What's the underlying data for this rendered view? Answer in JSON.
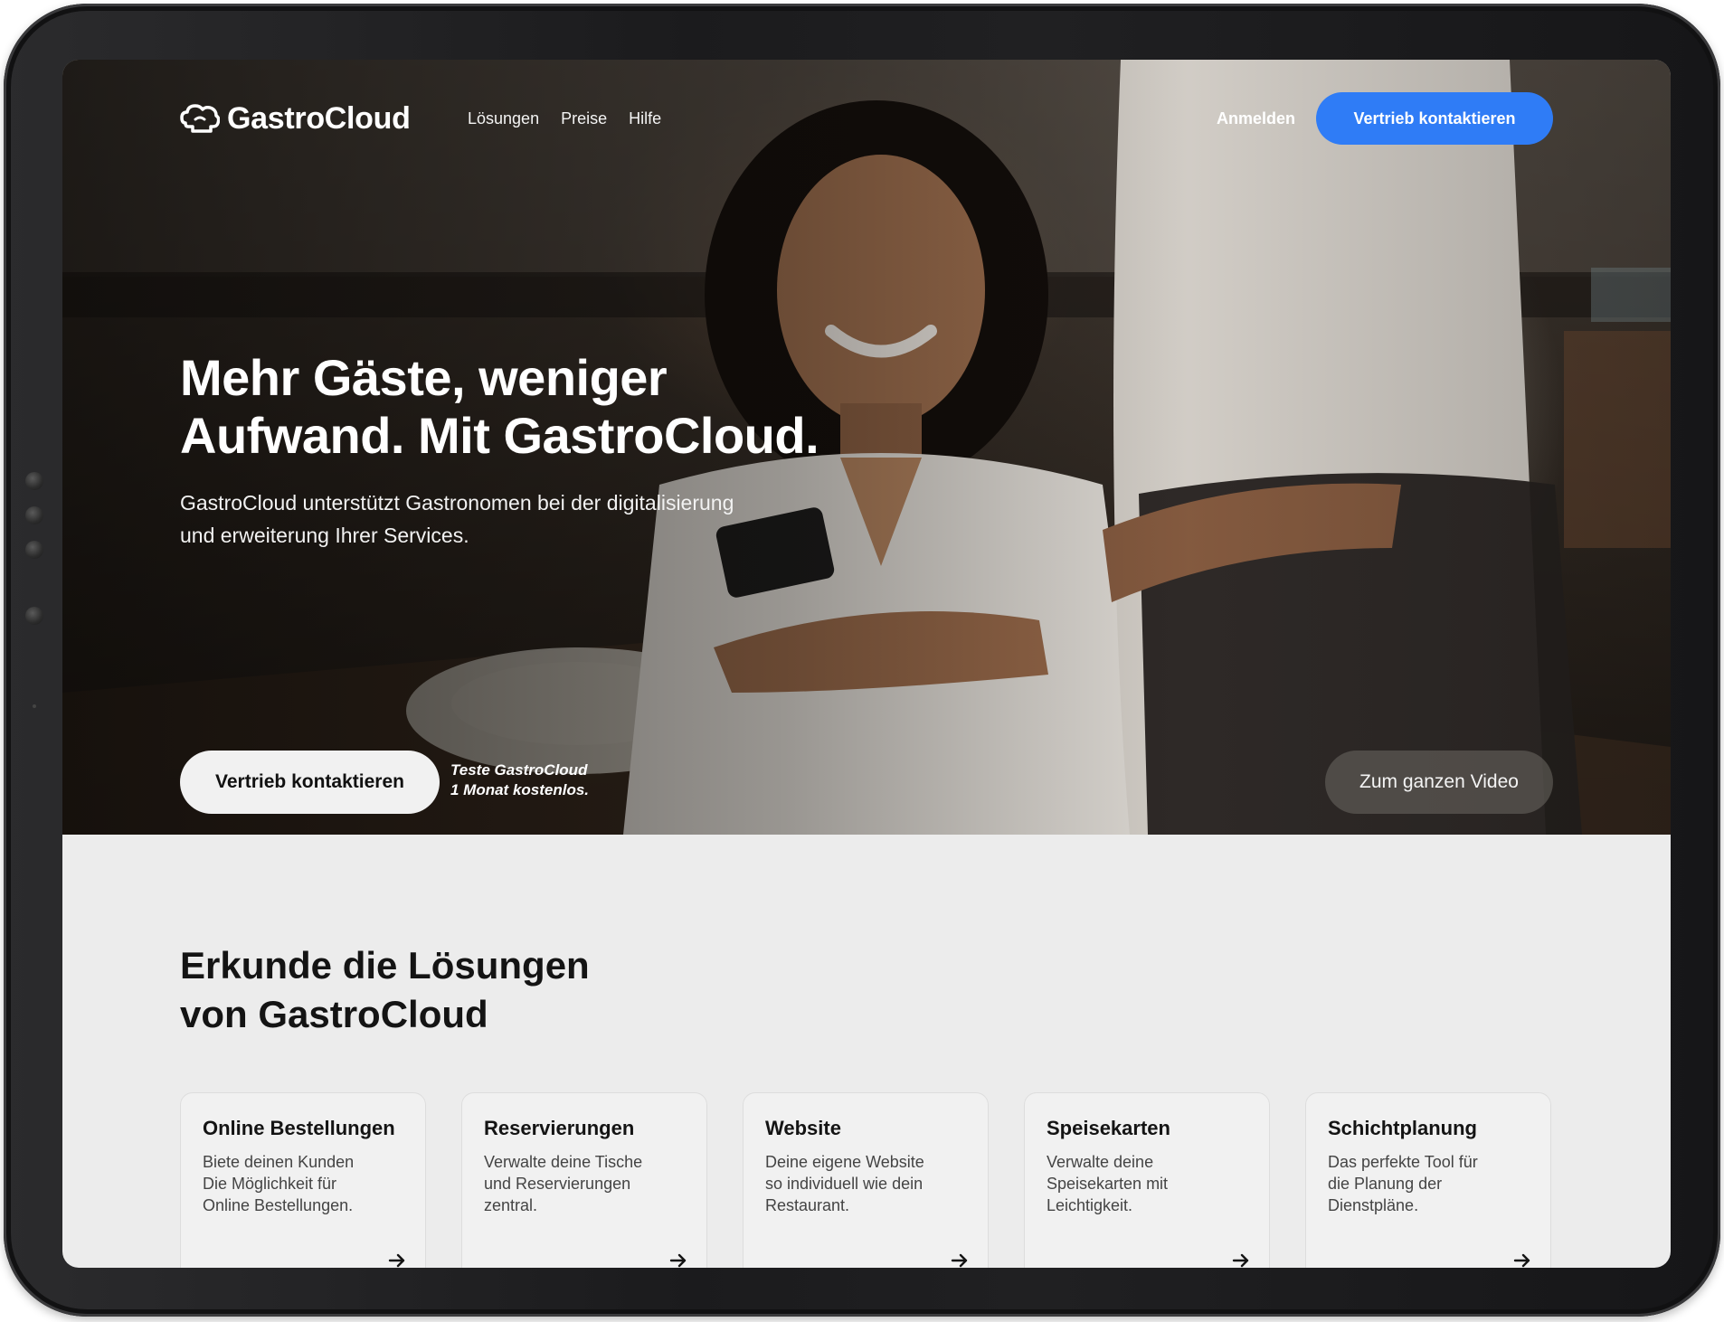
{
  "nav": {
    "logo": "GastroCloud",
    "links": [
      "Lösungen",
      "Preise",
      "Hilfe"
    ],
    "login": "Anmelden",
    "cta": "Vertrieb kontaktieren"
  },
  "hero": {
    "headline_line1": "Mehr Gäste, weniger",
    "headline_line2": "Aufwand. Mit GastroCloud.",
    "subline_line1": "GastroCloud unterstützt Gastronomen bei der digitalisierung",
    "subline_line2": "und erweiterung Ihrer Services.",
    "cta": "Vertrieb kontaktieren",
    "trial_line1": "Teste GastroCloud",
    "trial_line2": "1 Monat kostenlos.",
    "video_button": "Zum ganzen Video"
  },
  "solutions": {
    "title_line1": "Erkunde die Lösungen",
    "title_line2": "von GastroCloud",
    "cards": [
      {
        "title": "Online Bestellungen",
        "text": [
          "Biete deinen Kunden",
          "Die Möglichkeit für",
          "Online Bestellungen."
        ]
      },
      {
        "title": "Reservierungen",
        "text": [
          "Verwalte deine Tische",
          "und Reservierungen",
          "zentral."
        ]
      },
      {
        "title": "Website",
        "text": [
          "Deine eigene Website",
          "so individuell wie dein",
          "Restaurant."
        ]
      },
      {
        "title": "Speisekarten",
        "text": [
          "Verwalte deine",
          "Speisekarten mit",
          "Leichtigkeit."
        ]
      },
      {
        "title": "Schichtplanung",
        "text": [
          "Das perfekte Tool für",
          "die Planung der",
          "Dienstpläne."
        ]
      }
    ]
  },
  "icons": {
    "logo": "chef-hat-cloud-icon",
    "card_arrow": "arrow-right-icon"
  },
  "colors": {
    "accent": "#2f7cf6",
    "section_bg": "#ececec",
    "card_bg": "#f1f1f1",
    "text_dark": "#141414"
  }
}
